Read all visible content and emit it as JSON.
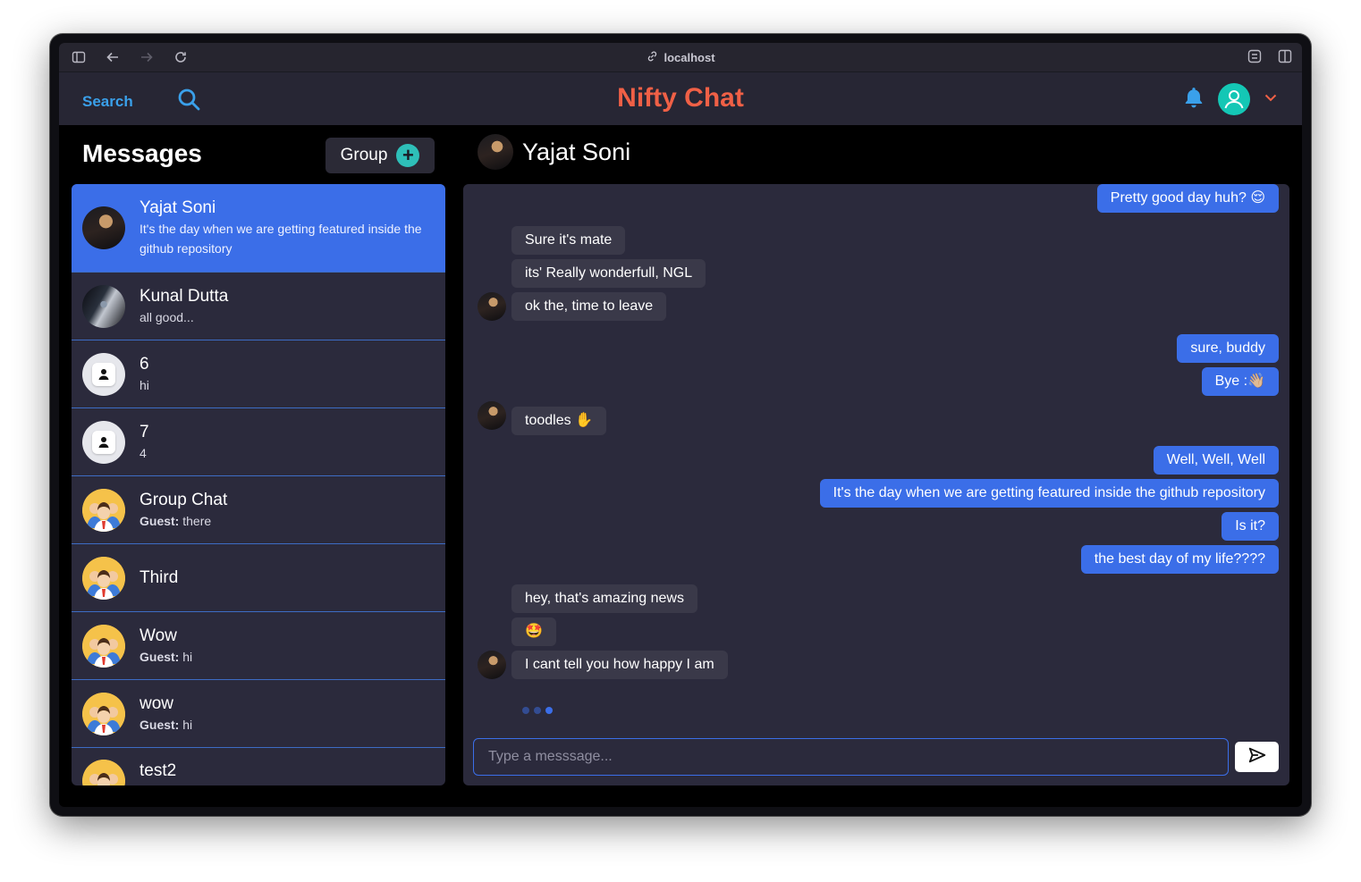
{
  "browser": {
    "url": "localhost"
  },
  "header": {
    "search_label": "Search",
    "brand": "Nifty Chat",
    "accent": "#3aa0ea",
    "brand_color": "#f06046"
  },
  "sidebar": {
    "title": "Messages",
    "group_button": "Group",
    "chats": [
      {
        "name": "Yajat Soni",
        "preview": "It's the day when we are getting featured inside the github repository",
        "sender": "",
        "avatar": "photo",
        "active": true
      },
      {
        "name": "Kunal Dutta",
        "preview": "all good...",
        "sender": "",
        "avatar": "car"
      },
      {
        "name": "6",
        "preview": "hi",
        "sender": "",
        "avatar": "default"
      },
      {
        "name": "7",
        "preview": "4",
        "sender": "",
        "avatar": "default"
      },
      {
        "name": "Group Chat",
        "preview": "there",
        "sender": "Guest:",
        "avatar": "group"
      },
      {
        "name": "Third",
        "preview": "",
        "sender": "",
        "avatar": "group"
      },
      {
        "name": "Wow",
        "preview": "hi",
        "sender": "Guest:",
        "avatar": "group"
      },
      {
        "name": "wow",
        "preview": "hi",
        "sender": "Guest:",
        "avatar": "group"
      },
      {
        "name": "test2",
        "preview": "",
        "sender": "",
        "avatar": "group"
      }
    ]
  },
  "conversation": {
    "title": "Yajat Soni",
    "messages": [
      {
        "text": "Pretty good day huh? 😌",
        "dir": "out"
      },
      {
        "text": "Sure it's mate",
        "dir": "in"
      },
      {
        "text": "its' Really wonderfull, NGL",
        "dir": "in"
      },
      {
        "text": "ok the, time to leave",
        "dir": "in"
      },
      {
        "text": "sure, buddy",
        "dir": "out"
      },
      {
        "text": "Bye :👋🏼",
        "dir": "out"
      },
      {
        "text": "toodles ✋",
        "dir": "in"
      },
      {
        "text": "Well, Well, Well",
        "dir": "out"
      },
      {
        "text": "It's the day when we are getting featured inside the github repository",
        "dir": "out"
      },
      {
        "text": "Is it?",
        "dir": "out"
      },
      {
        "text": "the best day of my life????",
        "dir": "out"
      },
      {
        "text": "hey, that's amazing news",
        "dir": "in"
      },
      {
        "text": "🤩",
        "dir": "in"
      },
      {
        "text": "I cant tell you how happy I am",
        "dir": "in"
      }
    ],
    "composer_placeholder": "Type a messsage..."
  }
}
